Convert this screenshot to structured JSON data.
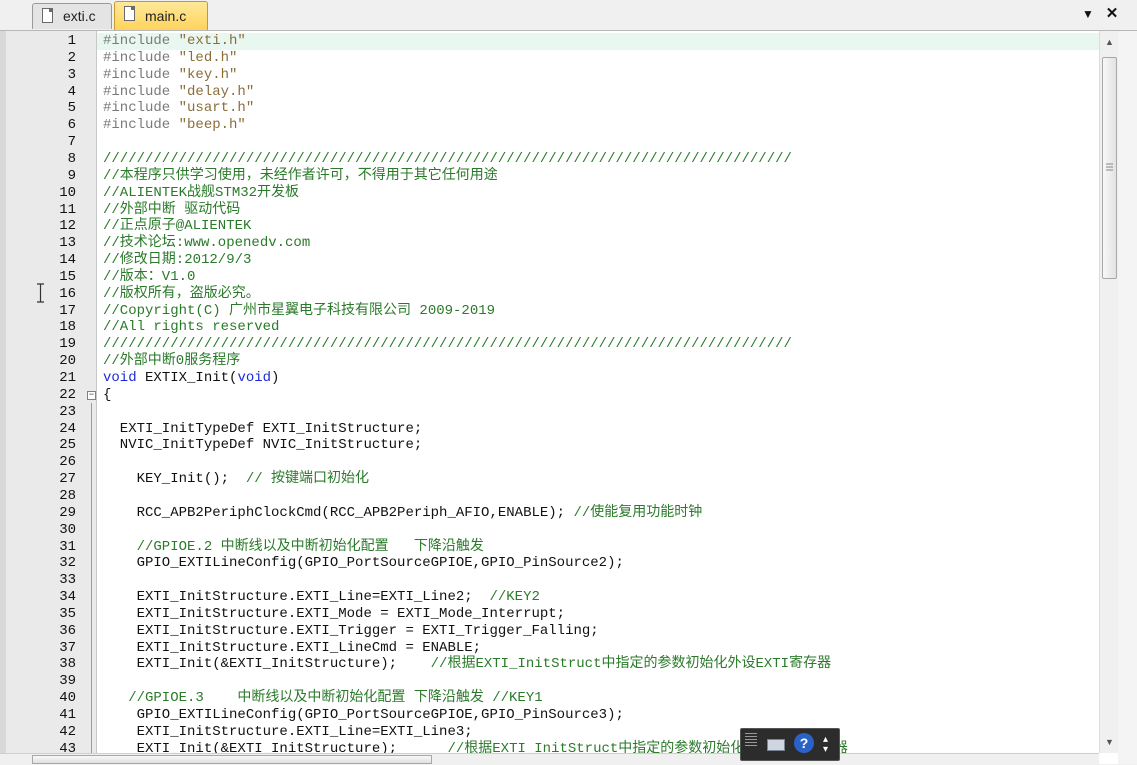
{
  "tabs": [
    {
      "label": "exti.c",
      "active": false
    },
    {
      "label": "main.c",
      "active": true
    }
  ],
  "window_controls": {
    "dropdown": "▼",
    "close": "✕"
  },
  "cursor_line": 1,
  "colors": {
    "keyword": "#1c2bd8",
    "comment": "#2a7a2a",
    "string": "#8a6d3b",
    "preprocessor": "#7a7a7a",
    "current_line": "#e8f7ef",
    "active_tab": "#ffd35c"
  },
  "lines": [
    {
      "n": "1",
      "tokens": [
        [
          "pre",
          "#include "
        ],
        [
          "str",
          "\"exti.h\""
        ]
      ]
    },
    {
      "n": "2",
      "tokens": [
        [
          "pre",
          "#include "
        ],
        [
          "str",
          "\"led.h\""
        ]
      ]
    },
    {
      "n": "3",
      "tokens": [
        [
          "pre",
          "#include "
        ],
        [
          "str",
          "\"key.h\""
        ]
      ]
    },
    {
      "n": "4",
      "tokens": [
        [
          "pre",
          "#include "
        ],
        [
          "str",
          "\"delay.h\""
        ]
      ]
    },
    {
      "n": "5",
      "tokens": [
        [
          "pre",
          "#include "
        ],
        [
          "str",
          "\"usart.h\""
        ]
      ]
    },
    {
      "n": "6",
      "tokens": [
        [
          "pre",
          "#include "
        ],
        [
          "str",
          "\"beep.h\""
        ]
      ]
    },
    {
      "n": "7",
      "tokens": []
    },
    {
      "n": "8",
      "tokens": [
        [
          "com",
          "//////////////////////////////////////////////////////////////////////////////////"
        ]
      ]
    },
    {
      "n": "9",
      "tokens": [
        [
          "com",
          "//本程序只供学习使用，未经作者许可，不得用于其它任何用途"
        ]
      ]
    },
    {
      "n": "10",
      "tokens": [
        [
          "com",
          "//ALIENTEK战舰STM32开发板"
        ]
      ]
    },
    {
      "n": "11",
      "tokens": [
        [
          "com",
          "//外部中断 驱动代码"
        ]
      ]
    },
    {
      "n": "12",
      "tokens": [
        [
          "com",
          "//正点原子@ALIENTEK"
        ]
      ]
    },
    {
      "n": "13",
      "tokens": [
        [
          "com",
          "//技术论坛:www.openedv.com"
        ]
      ]
    },
    {
      "n": "14",
      "tokens": [
        [
          "com",
          "//修改日期:2012/9/3"
        ]
      ]
    },
    {
      "n": "15",
      "tokens": [
        [
          "com",
          "//版本：V1.0"
        ]
      ]
    },
    {
      "n": "16",
      "tokens": [
        [
          "com",
          "//版权所有，盗版必究。"
        ]
      ]
    },
    {
      "n": "17",
      "tokens": [
        [
          "com",
          "//Copyright(C) 广州市星翼电子科技有限公司 2009-2019"
        ]
      ]
    },
    {
      "n": "18",
      "tokens": [
        [
          "com",
          "//All rights reserved"
        ]
      ]
    },
    {
      "n": "19",
      "tokens": [
        [
          "com",
          "//////////////////////////////////////////////////////////////////////////////////"
        ]
      ]
    },
    {
      "n": "20",
      "tokens": [
        [
          "com",
          "//外部中断0服务程序"
        ]
      ]
    },
    {
      "n": "21",
      "tokens": [
        [
          "kw",
          "void"
        ],
        [
          "txt",
          " EXTIX_Init("
        ],
        [
          "kw",
          "void"
        ],
        [
          "txt",
          ")"
        ]
      ]
    },
    {
      "n": "22",
      "tokens": [
        [
          "txt",
          "{"
        ]
      ],
      "fold": "open"
    },
    {
      "n": "23",
      "tokens": []
    },
    {
      "n": "24",
      "tokens": [
        [
          "txt",
          "  EXTI_InitTypeDef EXTI_InitStructure;"
        ]
      ]
    },
    {
      "n": "25",
      "tokens": [
        [
          "txt",
          "  NVIC_InitTypeDef NVIC_InitStructure;"
        ]
      ]
    },
    {
      "n": "26",
      "tokens": []
    },
    {
      "n": "27",
      "tokens": [
        [
          "txt",
          "    KEY_Init();  "
        ],
        [
          "com",
          "// 按键端口初始化"
        ]
      ]
    },
    {
      "n": "28",
      "tokens": []
    },
    {
      "n": "29",
      "tokens": [
        [
          "txt",
          "    RCC_APB2PeriphClockCmd(RCC_APB2Periph_AFIO,ENABLE); "
        ],
        [
          "com",
          "//使能复用功能时钟"
        ]
      ]
    },
    {
      "n": "30",
      "tokens": []
    },
    {
      "n": "31",
      "tokens": [
        [
          "com",
          "    //GPIOE.2 中断线以及中断初始化配置   下降沿触发"
        ]
      ]
    },
    {
      "n": "32",
      "tokens": [
        [
          "txt",
          "    GPIO_EXTILineConfig(GPIO_PortSourceGPIOE,GPIO_PinSource2);"
        ]
      ]
    },
    {
      "n": "33",
      "tokens": []
    },
    {
      "n": "34",
      "tokens": [
        [
          "txt",
          "    EXTI_InitStructure.EXTI_Line=EXTI_Line2;  "
        ],
        [
          "com",
          "//KEY2"
        ]
      ]
    },
    {
      "n": "35",
      "tokens": [
        [
          "txt",
          "    EXTI_InitStructure.EXTI_Mode = EXTI_Mode_Interrupt;"
        ]
      ]
    },
    {
      "n": "36",
      "tokens": [
        [
          "txt",
          "    EXTI_InitStructure.EXTI_Trigger = EXTI_Trigger_Falling;"
        ]
      ]
    },
    {
      "n": "37",
      "tokens": [
        [
          "txt",
          "    EXTI_InitStructure.EXTI_LineCmd = ENABLE;"
        ]
      ]
    },
    {
      "n": "38",
      "tokens": [
        [
          "txt",
          "    EXTI_Init(&EXTI_InitStructure);    "
        ],
        [
          "com",
          "//根据EXTI_InitStruct中指定的参数初始化外设EXTI寄存器"
        ]
      ]
    },
    {
      "n": "39",
      "tokens": []
    },
    {
      "n": "40",
      "tokens": [
        [
          "com",
          "   //GPIOE.3    中断线以及中断初始化配置 下降沿触发 //KEY1"
        ]
      ]
    },
    {
      "n": "41",
      "tokens": [
        [
          "txt",
          "    GPIO_EXTILineConfig(GPIO_PortSourceGPIOE,GPIO_PinSource3);"
        ]
      ]
    },
    {
      "n": "42",
      "tokens": [
        [
          "txt",
          "    EXTI_InitStructure.EXTI_Line=EXTI_Line3;"
        ]
      ]
    },
    {
      "n": "43",
      "tokens": [
        [
          "txt",
          "    EXTI_Init(&EXTI_InitStructure);      "
        ],
        [
          "com",
          "//根据EXTI_InitStruct中指定的参数初始化外设EXTI寄存器"
        ]
      ]
    }
  ]
}
